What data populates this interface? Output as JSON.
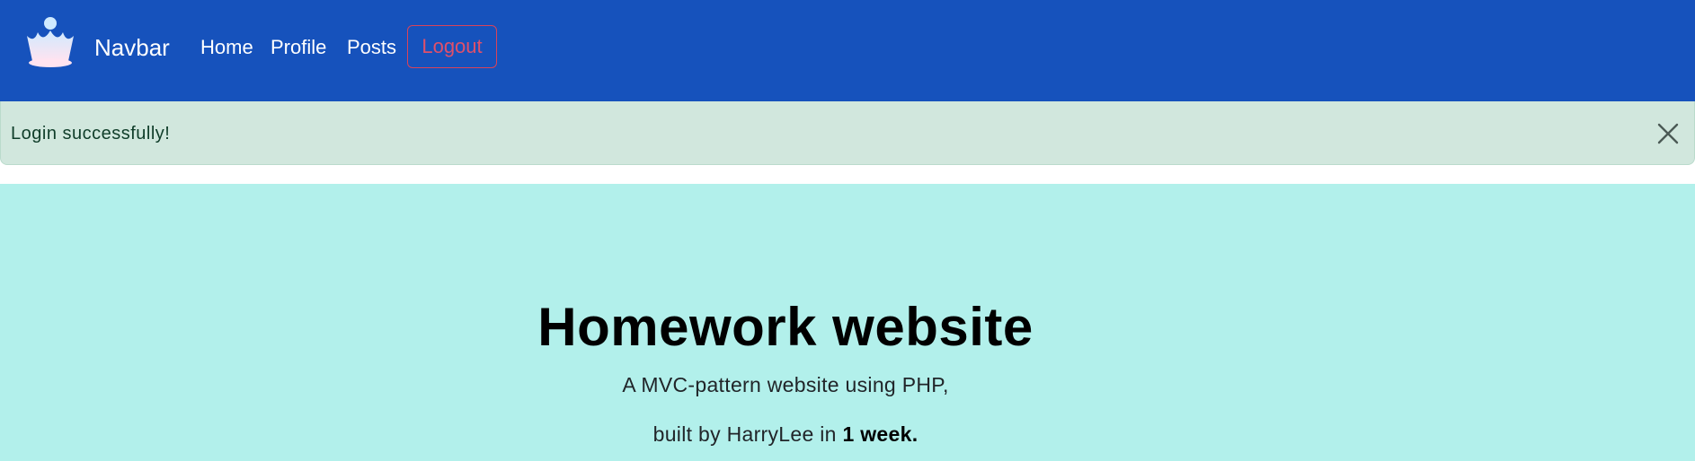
{
  "navbar": {
    "brand": "Navbar",
    "links": [
      {
        "label": "Home"
      },
      {
        "label": "Profile"
      },
      {
        "label": "Posts"
      }
    ],
    "logout_label": "Logout",
    "logo_icon": "crown-icon",
    "colors": {
      "background": "#1652bc",
      "logout": "#e0506a"
    }
  },
  "alert": {
    "message": "Login successfully!",
    "close_icon": "close-icon",
    "colors": {
      "background": "#d1e7dd"
    }
  },
  "hero": {
    "title": "Homework website",
    "line1": "A MVC-pattern website using PHP,",
    "line2_prefix": "built by HarryLee in ",
    "line2_bold": "1 week.",
    "colors": {
      "background": "#b2f0eb"
    }
  }
}
